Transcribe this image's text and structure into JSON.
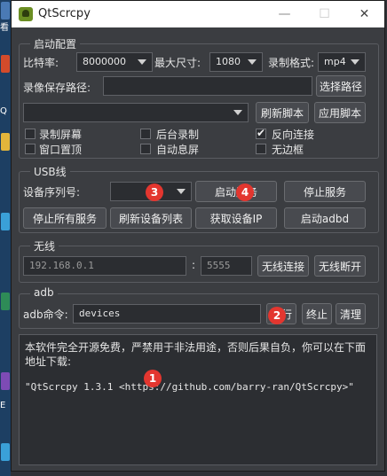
{
  "window": {
    "title": "QtScrcpy",
    "controls": {
      "minimize": "—",
      "maximize": "☐",
      "close": "✕"
    }
  },
  "desktop": {
    "glyph_1": "看",
    "glyph_2": "Q",
    "glyph_3": "E"
  },
  "config": {
    "title": "启动配置",
    "bitrate_label": "比特率:",
    "bitrate_value": "8000000",
    "maxsize_label": "最大尺寸:",
    "maxsize_value": "1080",
    "format_label": "录制格式:",
    "format_value": "mp4",
    "record_path_label": "录像保存路径:",
    "record_path_value": "",
    "select_path_button": "选择路径",
    "script_value": "",
    "refresh_script_button": "刷新脚本",
    "apply_script_button": "应用脚本",
    "record_screen_label": "录制屏幕",
    "background_record_label": "后台录制",
    "reverse_connect_label": "反向连接",
    "always_top_label": "窗口置顶",
    "auto_off_label": "自动息屏",
    "frameless_label": "无边框"
  },
  "usb": {
    "title": "USB线",
    "serial_label": "设备序列号:",
    "serial_value": "",
    "start_service_button": "启动服务",
    "stop_service_button": "停止服务",
    "stop_all_button": "停止所有服务",
    "refresh_devices_button": "刷新设备列表",
    "get_ip_button": "获取设备IP",
    "start_adbd_button": "启动adbd"
  },
  "wireless": {
    "title": "无线",
    "ip_placeholder": "192.168.0.1",
    "separator": ":",
    "port_placeholder": "5555",
    "connect_button": "无线连接",
    "disconnect_button": "无线断开"
  },
  "adb": {
    "title": "adb",
    "command_label": "adb命令:",
    "command_value": "devices",
    "execute_button": "执行",
    "terminate_button": "终止",
    "clear_button": "清理"
  },
  "log": {
    "notice": "本软件完全开源免费，严禁用于非法用途，否则后果自负，你可以在下面地址下载:",
    "version_line": "\"QtScrcpy 1.3.1 <https://github.com/barry-ran/QtScrcpy>\""
  },
  "badges": {
    "b1": "1",
    "b2": "2",
    "b3": "3",
    "b4": "4"
  },
  "colors": {
    "badge": "#e3362f",
    "window_bg": "#3b3d41",
    "titlebar": "#ffffff"
  }
}
